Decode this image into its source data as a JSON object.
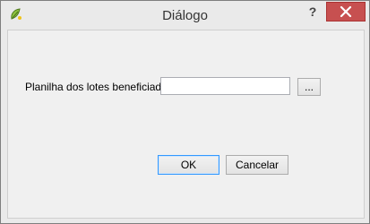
{
  "window": {
    "title": "Diálogo",
    "help_label": "?",
    "app_icon": "qgis-app-icon",
    "close_icon": "close-icon",
    "close_color": "#c75050"
  },
  "form": {
    "label": "Planilha dos lotes beneficiados:",
    "input_value": "",
    "browse_label": "..."
  },
  "buttons": {
    "ok_label": "OK",
    "cancel_label": "Cancelar"
  },
  "colors": {
    "window_bg": "#eaeaea",
    "client_bg": "#f0f0f0",
    "default_button_border": "#3399ff"
  }
}
